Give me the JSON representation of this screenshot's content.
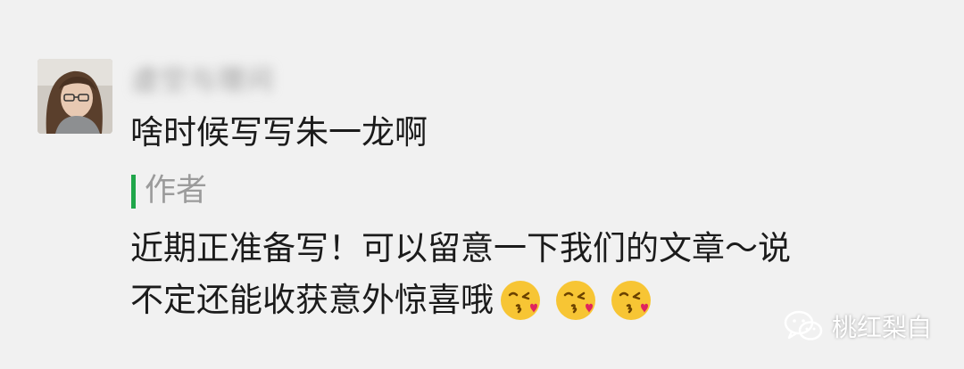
{
  "comment": {
    "username": "虚空与理问",
    "text": "啥时候写写朱一龙啊"
  },
  "reply": {
    "author_label": "作者",
    "line1": "近期正准备写！可以留意一下我们的文章～说",
    "line2": "不定还能收获意外惊喜哦",
    "emojis": [
      "kissing-heart-icon",
      "kissing-heart-icon",
      "kissing-heart-icon"
    ]
  },
  "watermark": {
    "text": "桃红梨白",
    "icon": "wechat-icon"
  },
  "colors": {
    "background": "#f1f1f1",
    "reply_bar": "#1fa64a",
    "author_label": "#9b9b9b",
    "text": "#1b1b1b"
  }
}
